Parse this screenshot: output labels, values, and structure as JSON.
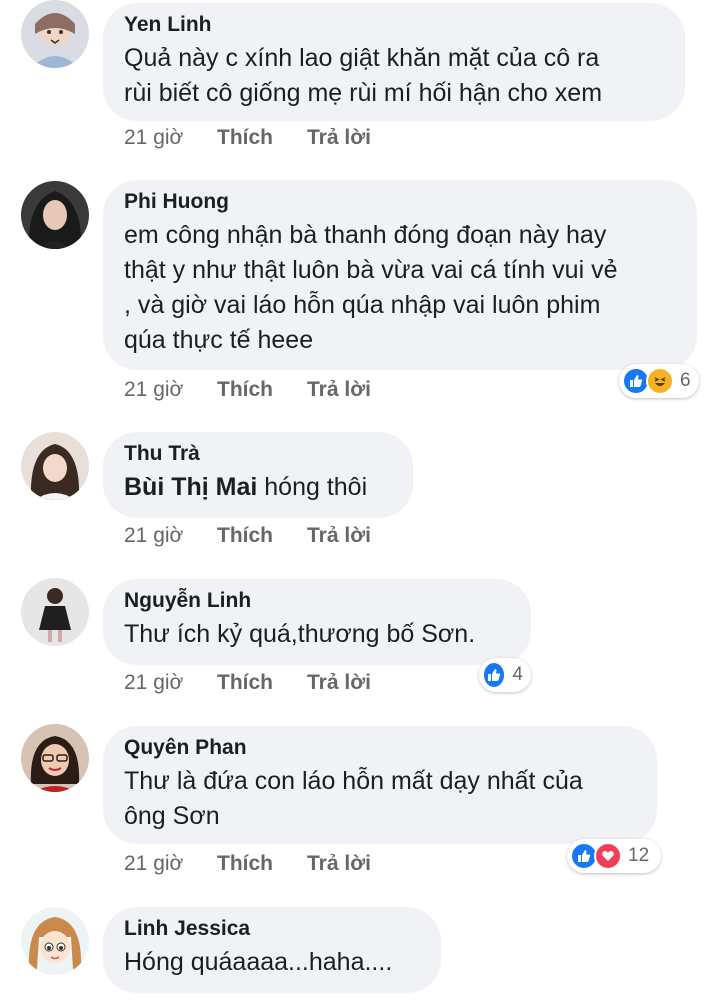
{
  "comments": [
    {
      "author": "Yen Linh",
      "text": "Quả này c xính lao giật khăn mặt của cô ra rùi biết cô giống mẹ rùi mí hối hận cho xem",
      "lines": [
        "Quả này c xính lao giật khăn mặt của cô ra",
        "rùi biết cô giống mẹ rùi mí hối hận cho xem"
      ],
      "time": "21 giờ",
      "like": "Thích",
      "reply": "Trả lời"
    },
    {
      "author": "Phi Huong",
      "lines": [
        "em công nhận bà thanh đóng đoạn này hay",
        "thật y như thật luôn bà vừa vai cá tính vui vẻ",
        ", và giờ vai láo hỗn qúa nhập vai luôn phim",
        "qúa thực tế heee"
      ],
      "time": "21 giờ",
      "like": "Thích",
      "reply": "Trả lời",
      "reactions": {
        "icons": [
          "like-icon",
          "haha-icon"
        ],
        "count": "6"
      }
    },
    {
      "author": "Thu Trà",
      "mention": "Bùi Thị Mai",
      "text_after_mention": " hóng thôi",
      "time": "21 giờ",
      "like": "Thích",
      "reply": "Trả lời"
    },
    {
      "author": "Nguyễn Linh",
      "lines": [
        "Thư ích kỷ quá,thương bố Sơn."
      ],
      "time": "21 giờ",
      "like": "Thích",
      "reply": "Trả lời",
      "reactions": {
        "icons": [
          "like-icon"
        ],
        "count": "4"
      }
    },
    {
      "author": "Quyên Phan",
      "lines": [
        "Thư là đứa con láo hỗn mất dạy nhất của",
        "ông Sơn"
      ],
      "time": "21 giờ",
      "like": "Thích",
      "reply": "Trả lời",
      "reactions": {
        "icons": [
          "like-icon",
          "love-icon"
        ],
        "count": "12"
      }
    },
    {
      "author": "Linh Jessica",
      "lines": [
        "Hóng quáaaaa...haha...."
      ]
    }
  ],
  "colors": {
    "bubble": "#f0f2f5",
    "meta_text": "#65676b",
    "like_blue": "#1877f2",
    "love_red": "#f33e58",
    "haha_yellow": "#f7b125"
  }
}
